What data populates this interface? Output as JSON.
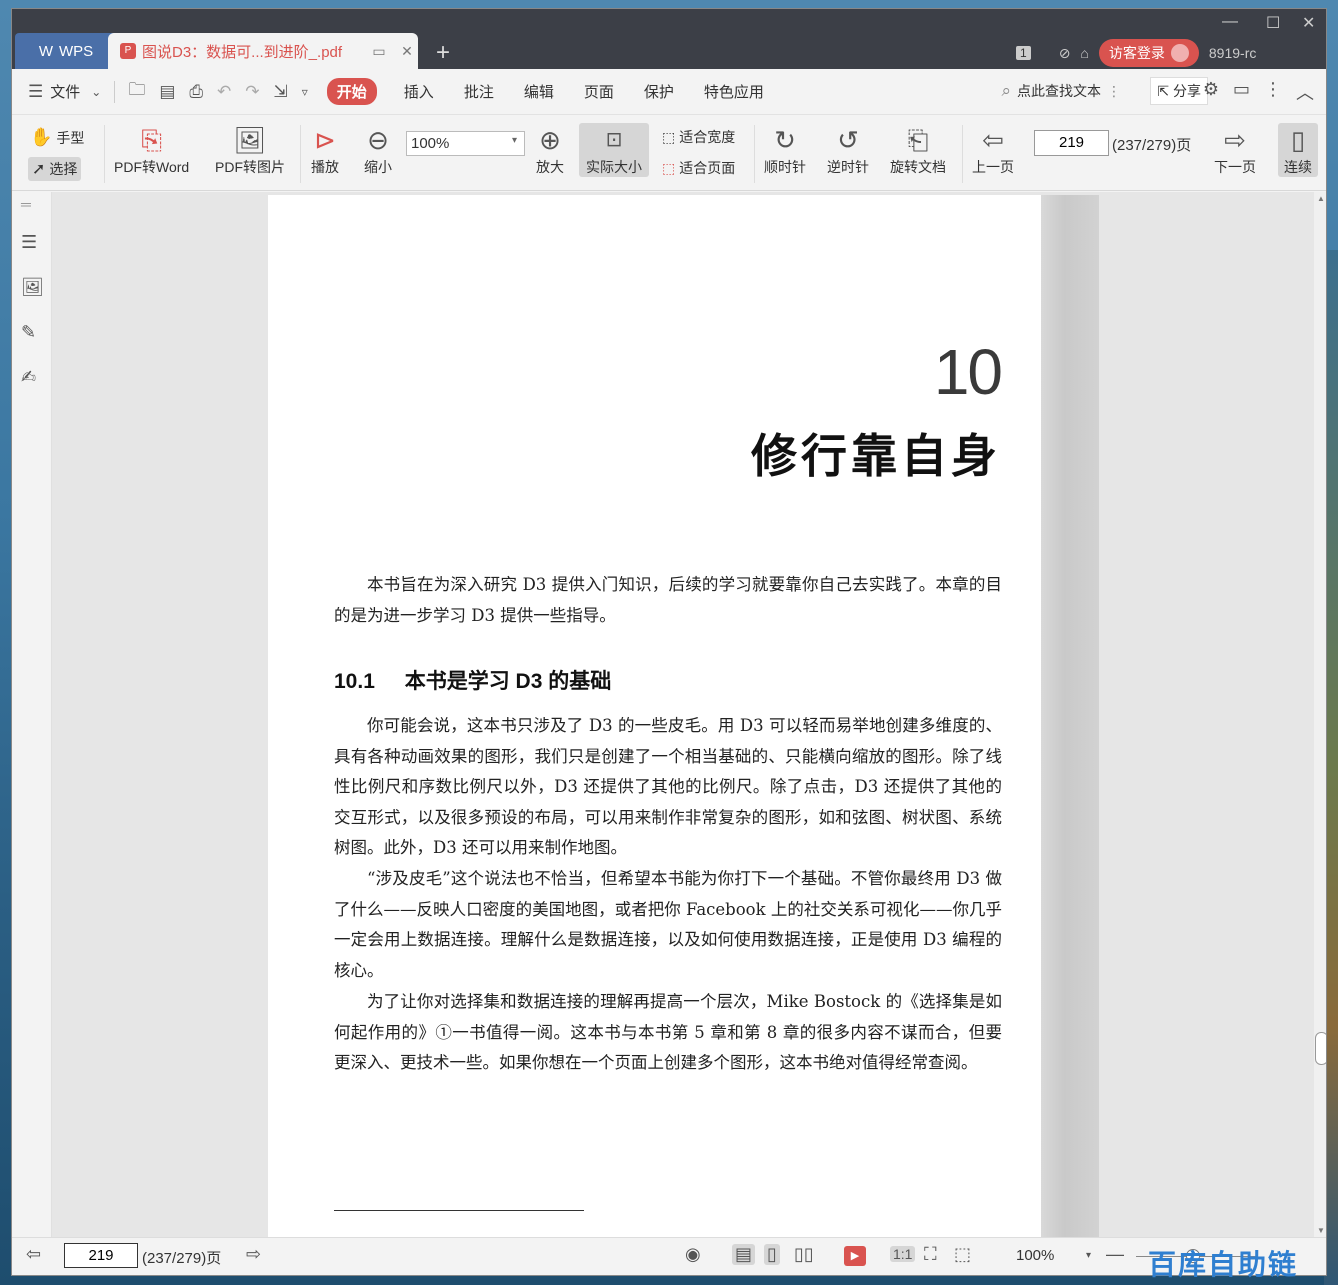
{
  "app": {
    "name": "WPS",
    "tab_title": "图说D3：数据可...到进阶_.pdf",
    "user_label": "8919-rc",
    "tab_count": "1",
    "login_label": "访客登录"
  },
  "menu": {
    "file": "文件",
    "items": [
      "开始",
      "插入",
      "批注",
      "编辑",
      "页面",
      "保护",
      "特色应用"
    ],
    "search": "点此查找文本",
    "share": "分享"
  },
  "toolbar": {
    "hand": "手型",
    "select": "选择",
    "pdf_word": "PDF转Word",
    "pdf_image": "PDF转图片",
    "play": "播放",
    "zoom_out": "缩小",
    "zoom_value": "100%",
    "zoom_in": "放大",
    "actual_size": "实际大小",
    "fit_width": "适合宽度",
    "fit_page": "适合页面",
    "clockwise": "顺时针",
    "counterclockwise": "逆时针",
    "rotate_doc": "旋转文档",
    "prev_page": "上一页",
    "page_input": "219",
    "page_total": "(237/279)页",
    "next_page": "下一页",
    "continuous": "连续"
  },
  "document": {
    "chapter_number": "10",
    "chapter_title": "修行靠自身",
    "intro": "本书旨在为深入研究 D3 提供入门知识，后续的学习就要靠你自己去实践了。本章的目的是为进一步学习 D3 提供一些指导。",
    "section_number": "10.1",
    "section_title": "本书是学习 D3 的基础",
    "paragraphs": [
      "你可能会说，这本书只涉及了 D3 的一些皮毛。用 D3 可以轻而易举地创建多维度的、具有各种动画效果的图形，我们只是创建了一个相当基础的、只能横向缩放的图形。除了线性比例尺和序数比例尺以外，D3 还提供了其他的比例尺。除了点击，D3 还提供了其他的交互形式，以及很多预设的布局，可以用来制作非常复杂的图形，如和弦图、树状图、系统树图。此外，D3 还可以用来制作地图。",
      "“涉及皮毛”这个说法也不恰当，但希望本书能为你打下一个基础。不管你最终用 D3 做了什么——反映人口密度的美国地图，或者把你 Facebook 上的社交关系可视化——你几乎一定会用上数据连接。理解什么是数据连接，以及如何使用数据连接，正是使用 D3 编程的核心。",
      "为了让你对选择集和数据连接的理解再提高一个层次，Mike Bostock 的《选择集是如何起作用的》①一书值得一阅。这本书与本书第 5 章和第 8 章的很多内容不谋而合，但要更深入、更技术一些。如果你想在一个页面上创建多个图形，这本书绝对值得经常查阅。"
    ]
  },
  "status": {
    "page_input": "219",
    "page_total": "(237/279)页",
    "zoom": "100%"
  },
  "watermark": "百库自助链"
}
